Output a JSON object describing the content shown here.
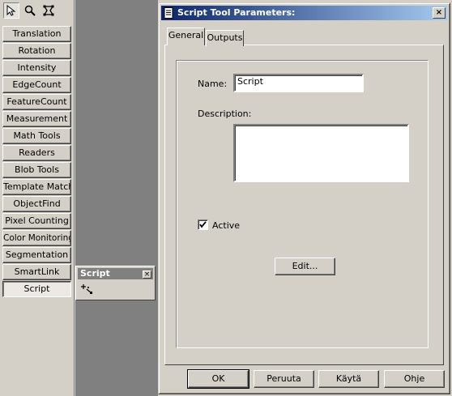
{
  "sidebar": {
    "tools": [
      {
        "icon": "pointer-icon"
      },
      {
        "icon": "magnifier-icon"
      },
      {
        "icon": "region-select-icon"
      }
    ],
    "items": [
      {
        "label": "Translation"
      },
      {
        "label": "Rotation"
      },
      {
        "label": "Intensity"
      },
      {
        "label": "EdgeCount"
      },
      {
        "label": "FeatureCount"
      },
      {
        "label": "Measurement"
      },
      {
        "label": "Math Tools"
      },
      {
        "label": "Readers"
      },
      {
        "label": "Blob Tools"
      },
      {
        "label": "Template Match"
      },
      {
        "label": "ObjectFind"
      },
      {
        "label": "Pixel Counting"
      },
      {
        "label": "Color Monitoring"
      },
      {
        "label": "Segmentation"
      },
      {
        "label": "SmartLink"
      },
      {
        "label": "Script"
      }
    ],
    "selected": "Script"
  },
  "palette": {
    "title": "Script",
    "close": "×",
    "tool_icon": "script-tool-icon"
  },
  "dialog": {
    "title": "Script Tool Parameters:",
    "close": "×",
    "tabs": {
      "general": "General",
      "outputs": "Outputs"
    },
    "name_label": "Name:",
    "name_value": "Script",
    "description_label": "Description:",
    "description_value": "",
    "active_label": "Active",
    "active_checked": true,
    "edit_button": "Edit...",
    "ok_button": "OK",
    "cancel_button": "Peruuta",
    "apply_button": "Käytä",
    "help_button": "Ohje"
  }
}
